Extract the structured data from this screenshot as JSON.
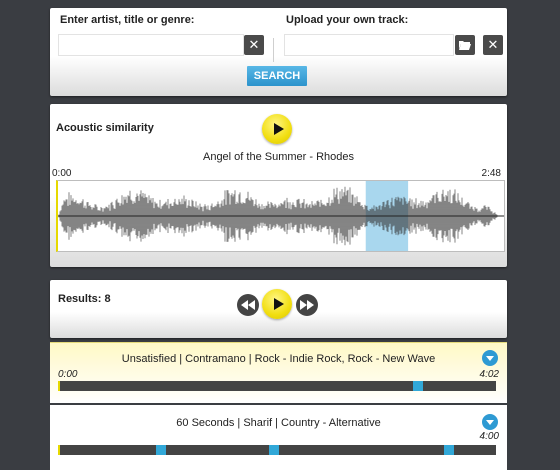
{
  "search": {
    "artist_label": "Enter artist, title or genre:",
    "artist_value": "",
    "upload_label": "Upload your own track:",
    "upload_value": "",
    "clear_icon": "close-icon",
    "folder_icon": "folder-open-icon",
    "search_label": "SEARCH"
  },
  "acoustic": {
    "heading": "Acoustic similarity",
    "track_title": "Angel of the Summer - Rhodes",
    "start_time": "0:00",
    "end_time": "2:48",
    "selection": {
      "start_fraction": 0.69,
      "end_fraction": 0.785
    },
    "selection_color": "#a9d7ee"
  },
  "results": {
    "label": "Results:",
    "count": "8"
  },
  "tracks": [
    {
      "title": "Unsatisfied | Contramano | Rock - Indie Rock, Rock - New Wave",
      "start_time": "0:00",
      "end_time": "4:02",
      "markers": [
        0.81
      ],
      "highlighted": true
    },
    {
      "title": "60 Seconds | Sharif | Country - Alternative",
      "start_time": "",
      "end_time": "4:00",
      "markers": [
        0.22,
        0.48,
        0.88
      ],
      "highlighted": false
    }
  ],
  "colors": {
    "accent_blue": "#2e9ad3",
    "play_yellow": "#f1de10",
    "background": "#3a3d42"
  }
}
